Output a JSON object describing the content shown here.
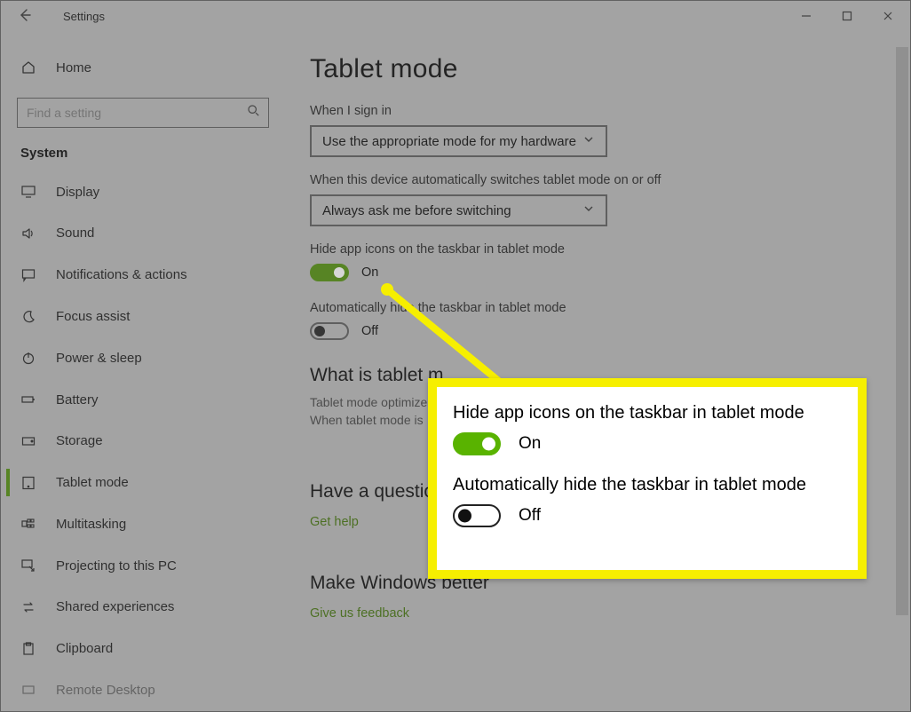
{
  "titlebar": {
    "title": "Settings"
  },
  "sidebar": {
    "home": "Home",
    "search_placeholder": "Find a setting",
    "section": "System",
    "items": [
      {
        "label": "Display"
      },
      {
        "label": "Sound"
      },
      {
        "label": "Notifications & actions"
      },
      {
        "label": "Focus assist"
      },
      {
        "label": "Power & sleep"
      },
      {
        "label": "Battery"
      },
      {
        "label": "Storage"
      },
      {
        "label": "Tablet mode",
        "active": true
      },
      {
        "label": "Multitasking"
      },
      {
        "label": "Projecting to this PC"
      },
      {
        "label": "Shared experiences"
      },
      {
        "label": "Clipboard"
      },
      {
        "label": "Remote Desktop"
      }
    ]
  },
  "page": {
    "title": "Tablet mode",
    "signin_label": "When I sign in",
    "signin_value": "Use the appropriate mode for my hardware",
    "switch_label": "When this device automatically switches tablet mode on or off",
    "switch_value": "Always ask me before switching",
    "hide_icons_label": "Hide app icons on the taskbar in tablet mode",
    "hide_icons_state": "On",
    "auto_hide_label": "Automatically hide the taskbar in tablet mode",
    "auto_hide_state": "Off",
    "what_head": "What is tablet m",
    "what_desc_l1": "Tablet mode optimize",
    "what_desc_l2": "When tablet mode is",
    "question_head": "Have a question",
    "get_help": "Get help",
    "better_head": "Make Windows better",
    "feedback": "Give us feedback"
  },
  "callout": {
    "l1": "Hide app icons on the taskbar in tablet mode",
    "s1": "On",
    "l2": "Automatically hide the taskbar in tablet mode",
    "s2": "Off"
  }
}
